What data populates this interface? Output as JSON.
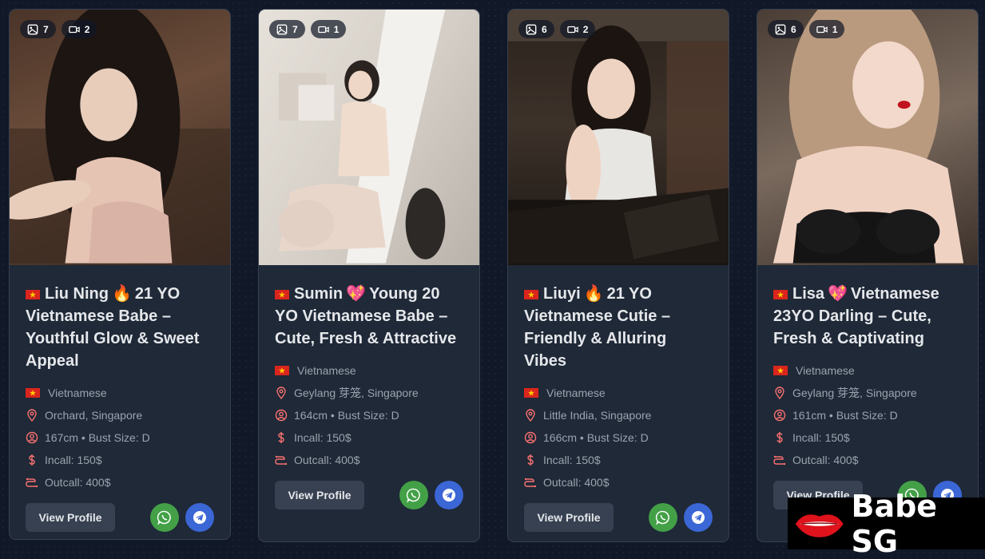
{
  "cards": [
    {
      "photo_count": "7",
      "video_count": "2",
      "emoji": "🔥",
      "title_name": "Liu Ning",
      "title_rest": "21 YO Vietnamese Babe – Youthful Glow & Sweet Appeal",
      "nationality": "Vietnamese",
      "location": "Orchard, Singapore",
      "stats": "167cm • Bust Size: D",
      "incall": "Incall: 150$",
      "outcall": "Outcall: 400$",
      "view_label": "View Profile"
    },
    {
      "photo_count": "7",
      "video_count": "1",
      "emoji": "💖",
      "title_name": "Sumin",
      "title_rest": "Young 20 YO Vietnamese Babe – Cute, Fresh & Attractive",
      "nationality": "Vietnamese",
      "location": "Geylang 芽笼, Singapore",
      "stats": "164cm • Bust Size: D",
      "incall": "Incall: 150$",
      "outcall": "Outcall: 400$",
      "view_label": "View Profile"
    },
    {
      "photo_count": "6",
      "video_count": "2",
      "emoji": "🔥",
      "title_name": "Liuyi",
      "title_rest": "21 YO Vietnamese Cutie – Friendly & Alluring Vibes",
      "nationality": "Vietnamese",
      "location": "Little India, Singapore",
      "stats": "166cm • Bust Size: D",
      "incall": "Incall: 150$",
      "outcall": "Outcall: 400$",
      "view_label": "View Profile"
    },
    {
      "photo_count": "6",
      "video_count": "1",
      "emoji": "💖",
      "title_name": "Lisa",
      "title_rest": "Vietnamese 23YO Darling – Cute, Fresh & Captivating",
      "nationality": "Vietnamese",
      "location": "Geylang 芽笼, Singapore",
      "stats": "161cm • Bust Size: D",
      "incall": "Incall: 150$",
      "outcall": "Outcall: 400$",
      "view_label": "View Profile"
    }
  ],
  "logo": {
    "text": "Babe SG"
  },
  "colors": {
    "card_bg": "#1f2937",
    "whatsapp": "#43a047",
    "telegram": "#3b66d6",
    "flag_red": "#da251d",
    "flag_star": "#ffcd00"
  }
}
